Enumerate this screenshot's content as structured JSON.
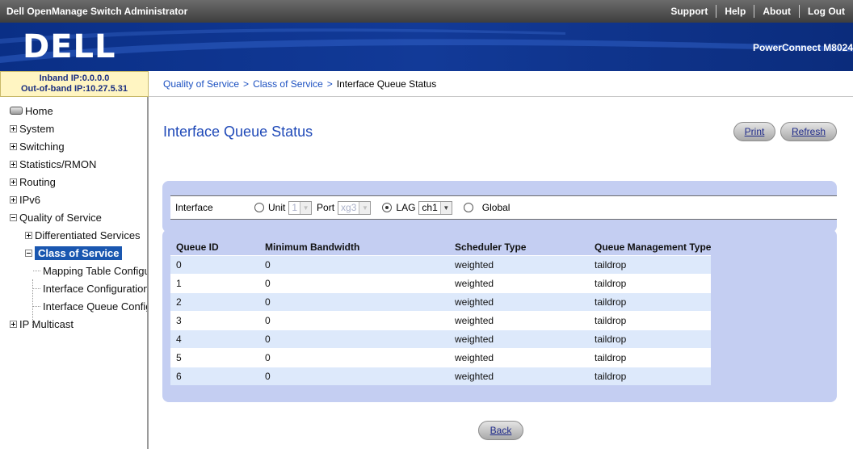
{
  "app": {
    "title": "Dell OpenManage Switch Administrator"
  },
  "topnav": [
    "Support",
    "Help",
    "About",
    "Log Out"
  ],
  "banner": {
    "logo": "DELL",
    "model": "PowerConnect M8024"
  },
  "ipinfo": {
    "inband": "Inband IP:0.0.0.0",
    "outofband": "Out-of-band IP:10.27.5.31"
  },
  "breadcrumb": {
    "items": [
      "Quality of Service",
      "Class of Service"
    ],
    "separator": ">",
    "current": "Interface Queue Status"
  },
  "sidebar": {
    "items": [
      {
        "label": "Home"
      },
      {
        "label": "System"
      },
      {
        "label": "Switching"
      },
      {
        "label": "Statistics/RMON"
      },
      {
        "label": "Routing"
      },
      {
        "label": "IPv6"
      },
      {
        "label": "Quality of Service"
      },
      {
        "label": "Differentiated Services"
      },
      {
        "label": "Class of Service"
      },
      {
        "label": "Mapping Table Configuration"
      },
      {
        "label": "Interface Configuration"
      },
      {
        "label": "Interface Queue Configuration"
      },
      {
        "label": "IP Multicast"
      }
    ]
  },
  "page": {
    "title": "Interface Queue Status",
    "print": "Print",
    "refresh": "Refresh",
    "back": "Back"
  },
  "interface": {
    "label": "Interface",
    "unit_label": "Unit",
    "unit_value": "1",
    "port_label": "Port",
    "port_value": "xg3",
    "lag_label": "LAG",
    "lag_value": "ch1",
    "global_label": "Global",
    "selected": "LAG"
  },
  "table": {
    "headers": [
      "Queue ID",
      "Minimum Bandwidth",
      "Scheduler Type",
      "Queue Management Type"
    ],
    "rows": [
      [
        "0",
        "0",
        "weighted",
        "taildrop"
      ],
      [
        "1",
        "0",
        "weighted",
        "taildrop"
      ],
      [
        "2",
        "0",
        "weighted",
        "taildrop"
      ],
      [
        "3",
        "0",
        "weighted",
        "taildrop"
      ],
      [
        "4",
        "0",
        "weighted",
        "taildrop"
      ],
      [
        "5",
        "0",
        "weighted",
        "taildrop"
      ],
      [
        "6",
        "0",
        "weighted",
        "taildrop"
      ]
    ]
  },
  "colors": {
    "banner": "#0a2f86",
    "panel": "#c4cef2",
    "title": "#1f49b8",
    "row_alt": "#dde9fb",
    "active_nav": "#1a57b0"
  }
}
